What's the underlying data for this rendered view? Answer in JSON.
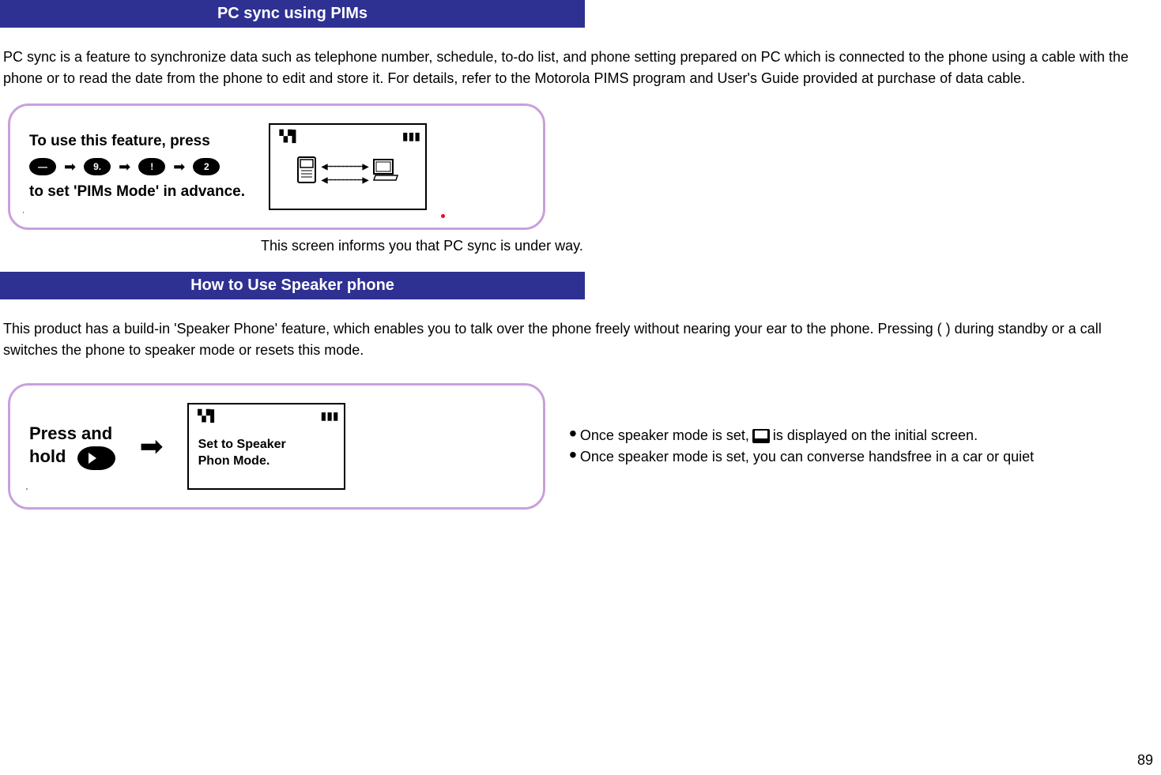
{
  "header1": "PC sync using PIMs",
  "para1": "PC sync is a feature to synchronize data such as telephone number, schedule, to-do list, and phone setting prepared on PC which is connected to the phone using a cable with the phone or to read the date from the phone to edit and store it. For details, refer to the Motorola PIMS program and User's Guide provided at purchase of data cable.",
  "box1": {
    "line1": "To use this feature, press",
    "pills": [
      "—",
      "9.",
      "!",
      "2"
    ],
    "line2": "to set 'PIMs Mode' in advance."
  },
  "caption1": "This screen informs you that PC sync is under way.",
  "header2": "How to Use Speaker phone",
  "para2": "This product has a build-in 'Speaker Phone' feature, which enables you to talk over the phone freely without nearing your ear to the phone. Pressing (  ) during standby or a call switches the phone to speaker mode or resets this mode.",
  "box2": {
    "press": "Press and\nhold",
    "lcd_text": "Set to Speaker\nPhon Mode."
  },
  "bullets": {
    "b1a": "Once speaker mode is set,",
    "b1b": "is displayed on the initial screen.",
    "b2": "Once speaker mode is set, you can converse handsfree in a car or quiet"
  },
  "signal_glyph": "▝▞▌",
  "battery_glyph": "▮▮▮",
  "arrow": "➡",
  "page_number": "89"
}
